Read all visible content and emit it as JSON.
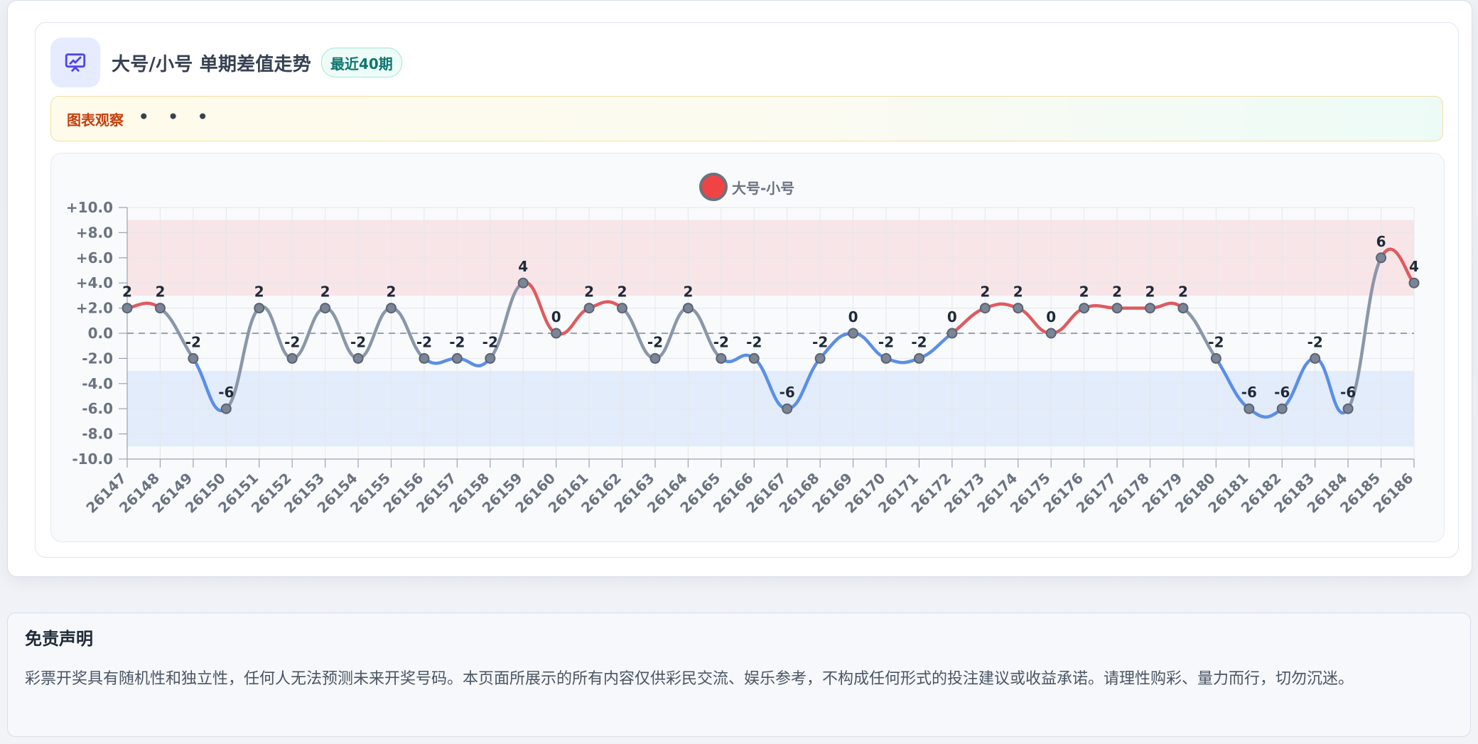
{
  "header": {
    "title": "大号/小号 单期差值走势",
    "badge": "最近40期",
    "icon": "presentation-chart-icon",
    "accent": "#4f46e5"
  },
  "observation": {
    "label": "图表观察",
    "more": "• • •"
  },
  "legend": {
    "label": "大号-小号",
    "swatch_color": "#ef4444",
    "swatch_border": "#6b7280"
  },
  "chart_data": {
    "type": "line",
    "title": "",
    "xlabel": "",
    "ylabel": "",
    "ylim": [
      -10,
      10
    ],
    "yticks": [
      "+10.0",
      "+8.0",
      "+6.0",
      "+4.0",
      "+2.0",
      "0.0",
      "-2.0",
      "-4.0",
      "-6.0",
      "-8.0",
      "-10.0"
    ],
    "grid": true,
    "legend_position": "top-center",
    "categories": [
      "26147",
      "26148",
      "26149",
      "26150",
      "26151",
      "26152",
      "26153",
      "26154",
      "26155",
      "26156",
      "26157",
      "26158",
      "26159",
      "26160",
      "26161",
      "26162",
      "26163",
      "26164",
      "26165",
      "26166",
      "26167",
      "26168",
      "26169",
      "26170",
      "26171",
      "26172",
      "26173",
      "26174",
      "26175",
      "26176",
      "26177",
      "26178",
      "26179",
      "26180",
      "26181",
      "26182",
      "26183",
      "26184",
      "26185",
      "26186"
    ],
    "series": [
      {
        "name": "大号-小号",
        "values": [
          2,
          2,
          -2,
          -6,
          2,
          -2,
          2,
          -2,
          2,
          -2,
          -2,
          -2,
          4,
          0,
          2,
          2,
          -2,
          2,
          -2,
          -2,
          -6,
          -2,
          0,
          -2,
          -2,
          0,
          2,
          2,
          0,
          2,
          2,
          2,
          2,
          -2,
          -6,
          -6,
          -2,
          -6,
          6,
          4
        ]
      }
    ],
    "bands": [
      {
        "from": 3,
        "to": 9,
        "color": "#f7dde2"
      },
      {
        "from": -9,
        "to": -3,
        "color": "#dbe7fb"
      }
    ],
    "colors": {
      "positive": "#e05a5f",
      "negative": "#5b8ee8",
      "mixed": "#8b97a8",
      "point_fill": "#7b8595",
      "point_border": "#5b6372",
      "zero_line": "#98a2b3",
      "grid": "#e5e7eb"
    }
  },
  "disclaimer": {
    "title": "免责声明",
    "text": "彩票开奖具有随机性和独立性，任何人无法预测未来开奖号码。本页面所展示的所有内容仅供彩民交流、娱乐参考，不构成任何形式的投注建议或收益承诺。请理性购彩、量力而行，切勿沉迷。"
  }
}
